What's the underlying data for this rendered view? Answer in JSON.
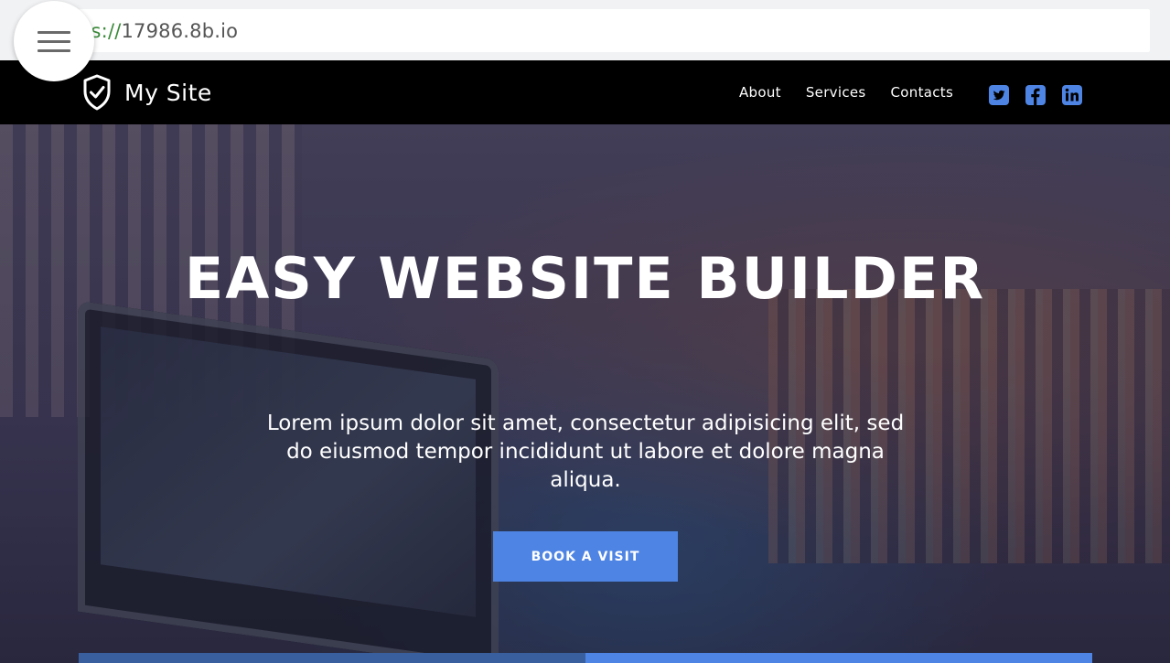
{
  "browser": {
    "url_scheme": "ps://",
    "url_host": "17986.8b.io"
  },
  "menu": {
    "icon": "hamburger-icon"
  },
  "navbar": {
    "brand_icon": "shield-check-icon",
    "brand_name": "My Site",
    "links": [
      "About",
      "Services",
      "Contacts"
    ],
    "socials": [
      "twitter-icon",
      "facebook-icon",
      "linkedin-icon"
    ],
    "social_color": "#4e84e3"
  },
  "hero": {
    "title": "EASY WEBSITE BUILDER",
    "subtitle": "Lorem ipsum dolor sit amet, consectetur adipisicing elit, sed do eiusmod tempor incididunt ut labore et dolore magna aliqua.",
    "button_label": "BOOK A VISIT",
    "accent": "#4e84e3"
  }
}
